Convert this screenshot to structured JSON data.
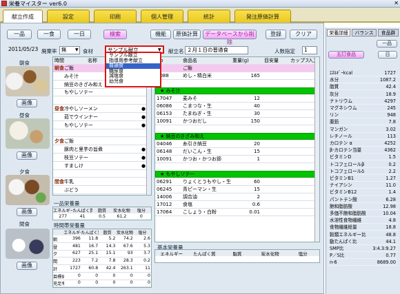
{
  "window": {
    "title": "栄養マイスター ver6.0"
  },
  "tabs": [
    "献立作成",
    "設定",
    "印刷",
    "個人管理",
    "統計",
    "発注原価計算"
  ],
  "toolbar": {
    "b_ippin": "一品",
    "b_ichishoku": "一食",
    "b_ichinichi": "一日",
    "b_search": "検索",
    "b_kinou": "機能",
    "b_genka": "原価計算",
    "b_delete": "データベースから削除",
    "b_register": "登録",
    "b_clear": "クリア"
  },
  "form": {
    "date": "2011/05/23",
    "haiki_label": "廃棄率",
    "haiki_value": "無",
    "shokuhin_label": "食材",
    "dropdown_value": "サンプル献立",
    "kondate_label": "献立名",
    "kondate_value": "２月１日の普通食",
    "ninzu_label": "人数指定",
    "ninzu_value": "1"
  },
  "dropdown": {
    "items": [
      "サンプル献立",
      "指導用参考献立",
      "普通食",
      "糖尿食",
      "減塩食",
      "幼児食"
    ],
    "selected": 2
  },
  "meals": {
    "breakfast": "朝食",
    "lunch": "昼食",
    "dinner": "夕食",
    "snack": "間食",
    "view_btn": "画像"
  },
  "menu_grid": {
    "header": [
      "時間",
      "名称"
    ],
    "rows": [
      {
        "cat": "朝食",
        "name": "ご飯",
        "dot": false,
        "pink": true
      },
      {
        "cat": "",
        "name": "みそ汁",
        "dot": false,
        "pink": false
      },
      {
        "cat": "",
        "name": "納豆のきざみ和え",
        "dot": false,
        "pink": false
      },
      {
        "cat": "",
        "name": "もやしソテー",
        "dot": false,
        "pink": false
      },
      {
        "cat": "",
        "name": "",
        "dot": false,
        "pink": false
      },
      {
        "cat": "昼食",
        "name": "冷やしソーメン",
        "dot": true,
        "pink": false
      },
      {
        "cat": "",
        "name": "茹でウインナー",
        "dot": true,
        "pink": false
      },
      {
        "cat": "",
        "name": "もやしソテー",
        "dot": true,
        "pink": false
      },
      {
        "cat": "",
        "name": "",
        "dot": false,
        "pink": false
      },
      {
        "cat": "夕食",
        "name": "ご飯",
        "dot": false,
        "pink": false
      },
      {
        "cat": "",
        "name": "豚肉と里芋の旨煮",
        "dot": true,
        "pink": false
      },
      {
        "cat": "",
        "name": "枝豆ソテー",
        "dot": true,
        "pink": false
      },
      {
        "cat": "",
        "name": "すましけ",
        "dot": true,
        "pink": false
      },
      {
        "cat": "",
        "name": "",
        "dot": false,
        "pink": false
      },
      {
        "cat": "間食",
        "name": "牛乳",
        "dot": false,
        "pink": false
      },
      {
        "cat": "",
        "name": "ぶどう",
        "dot": false,
        "pink": false
      }
    ]
  },
  "food_grid": {
    "header": [
      "No",
      "食品名",
      "重量(g)",
      "目安量",
      "カップスプーン",
      "入力"
    ],
    "sections": [
      {
        "title": "ご飯",
        "rows": [
          {
            "no": "1088",
            "name": "めし・精白米",
            "w": "165"
          }
        ]
      },
      {
        "title": "みそ汁",
        "rows": [
          {
            "no": "17047",
            "name": "麦みそ",
            "w": "12"
          },
          {
            "no": "06086",
            "name": "こまつな・生",
            "w": "40"
          },
          {
            "no": "06153",
            "name": "たまねぎ・生",
            "w": "30"
          },
          {
            "no": "10091",
            "name": "かつおだし",
            "w": "150"
          }
        ]
      },
      {
        "title": "納豆のきざみ和え",
        "rows": [
          {
            "no": "04046",
            "name": "糸引き納豆",
            "w": "20"
          },
          {
            "no": "06148",
            "name": "だいこん・生",
            "w": "15"
          },
          {
            "no": "10091",
            "name": "かつお・かつお節",
            "w": "1"
          }
        ]
      },
      {
        "title": "もやしソテー",
        "rows": [
          {
            "no": "06291",
            "name": "りょくとうもやし・生",
            "w": "60"
          },
          {
            "no": "06245",
            "name": "青ピーマン・生",
            "w": "15"
          },
          {
            "no": "14006",
            "name": "調合油",
            "w": "2"
          },
          {
            "no": "17012",
            "name": "食塩",
            "w": "0.6"
          },
          {
            "no": "17064",
            "name": "こしょう・白粉",
            "w": "0.01"
          }
        ]
      }
    ]
  },
  "ippin": {
    "title": "一品栄養量",
    "header": [
      "エネルギー",
      "たんぱく質",
      "脂質",
      "炭水化物",
      "塩分"
    ],
    "values": [
      "277",
      "41",
      "0.5",
      "61.2",
      "0"
    ]
  },
  "jikan": {
    "title": "時間帯栄養量",
    "header": [
      "",
      "エネルギー",
      "たんぱく質",
      "脂質",
      "炭水化物",
      "塩分"
    ],
    "rows": [
      [
        "朝",
        "396",
        "11.8",
        "5.2",
        "74.2",
        "2.6"
      ],
      [
        "昼",
        "481",
        "16.7",
        "14.3",
        "67.6",
        "5.3"
      ],
      [
        "夕",
        "627",
        "25.1",
        "15.1",
        "93",
        "3.7"
      ],
      [
        "間",
        "223",
        "7.2",
        "7.8",
        "28.3",
        "0.2"
      ],
      [
        "計",
        "1727",
        "60.8",
        "42.4",
        "263.1",
        "11"
      ],
      [
        "目標値",
        "0",
        "0",
        "0",
        "0",
        "0"
      ],
      [
        "充足率",
        "0",
        "0",
        "0",
        "0",
        "0"
      ]
    ]
  },
  "kihon": {
    "title": "基本栄養量",
    "header": [
      "エネルギー",
      "たんぱく質",
      "脂質",
      "炭水化物",
      "塩分"
    ]
  },
  "sidebar": {
    "tabs": [
      "栄養詳細",
      "バランス",
      "食品群"
    ],
    "btn_ippin": "一品",
    "btn_five": "五訂食品",
    "btn_ri": "日",
    "rows": [
      {
        "k": "ｴﾈﾙｷﾞｰkcal",
        "v": "1727"
      },
      {
        "k": "水分",
        "v": "1087.2"
      },
      {
        "k": "脂質",
        "v": "42.4"
      },
      {
        "k": "灰分",
        "v": "18.9"
      },
      {
        "k": "ナトリウム",
        "v": "4297"
      },
      {
        "k": "マグネシウム",
        "v": "245"
      },
      {
        "k": "リン",
        "v": "948"
      },
      {
        "k": "亜鉛",
        "v": "7.8"
      },
      {
        "k": "マンガン",
        "v": "3.02"
      },
      {
        "k": "レチノール",
        "v": "113"
      },
      {
        "k": "カロテン α",
        "v": "4252"
      },
      {
        "k": "β-カロテン当量",
        "v": "4362"
      },
      {
        "k": "ビタミンD",
        "v": "1.5"
      },
      {
        "k": "トコフェロールβ",
        "v": "0.2"
      },
      {
        "k": "トコフェロールδ",
        "v": "2.2"
      },
      {
        "k": "ビタミンB1",
        "v": "1.27"
      },
      {
        "k": "ナイアシン",
        "v": "11.0"
      },
      {
        "k": "ビタミンB12",
        "v": "1.4"
      },
      {
        "k": "パントテン酸",
        "v": "6.28"
      },
      {
        "k": "飽和脂肪酸",
        "v": "12.98"
      },
      {
        "k": "多価不飽和脂肪酸",
        "v": "10.04"
      },
      {
        "k": "水溶性食物繊維",
        "v": "4.8"
      },
      {
        "k": "食物繊維総量",
        "v": "18.8"
      },
      {
        "k": "穀類エネルギー比",
        "v": "48.8"
      },
      {
        "k": "動たんぱく比",
        "v": "44.1"
      },
      {
        "k": "SMP比",
        "v": "3:4.3:9.27"
      },
      {
        "k": "P／S比",
        "v": "0.77"
      },
      {
        "k": "n-6",
        "v": "8689.00"
      }
    ]
  }
}
